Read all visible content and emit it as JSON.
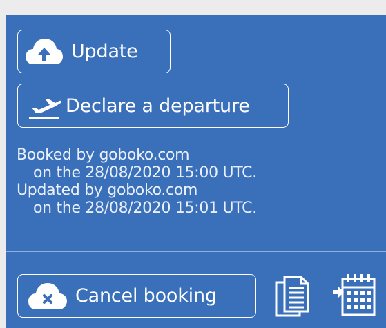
{
  "actions": {
    "update_label": "Update",
    "declare_departure_label": "Declare a departure",
    "cancel_booking_label": "Cancel booking"
  },
  "history": {
    "booked_by": "Booked by goboko.com",
    "booked_on": "on the 28/08/2020 15:00 UTC.",
    "updated_by": "Updated by goboko.com",
    "updated_on": "on the 28/08/2020 15:01 UTC."
  },
  "icons": {
    "update": "cloud-upload-icon",
    "departure": "plane-departure-icon",
    "cancel": "cloud-cancel-icon",
    "documents": "documents-icon",
    "calendar": "calendar-add-icon"
  },
  "colors": {
    "panel_background": "#3a6fba",
    "page_background": "#ececec",
    "foreground": "#ffffff"
  }
}
